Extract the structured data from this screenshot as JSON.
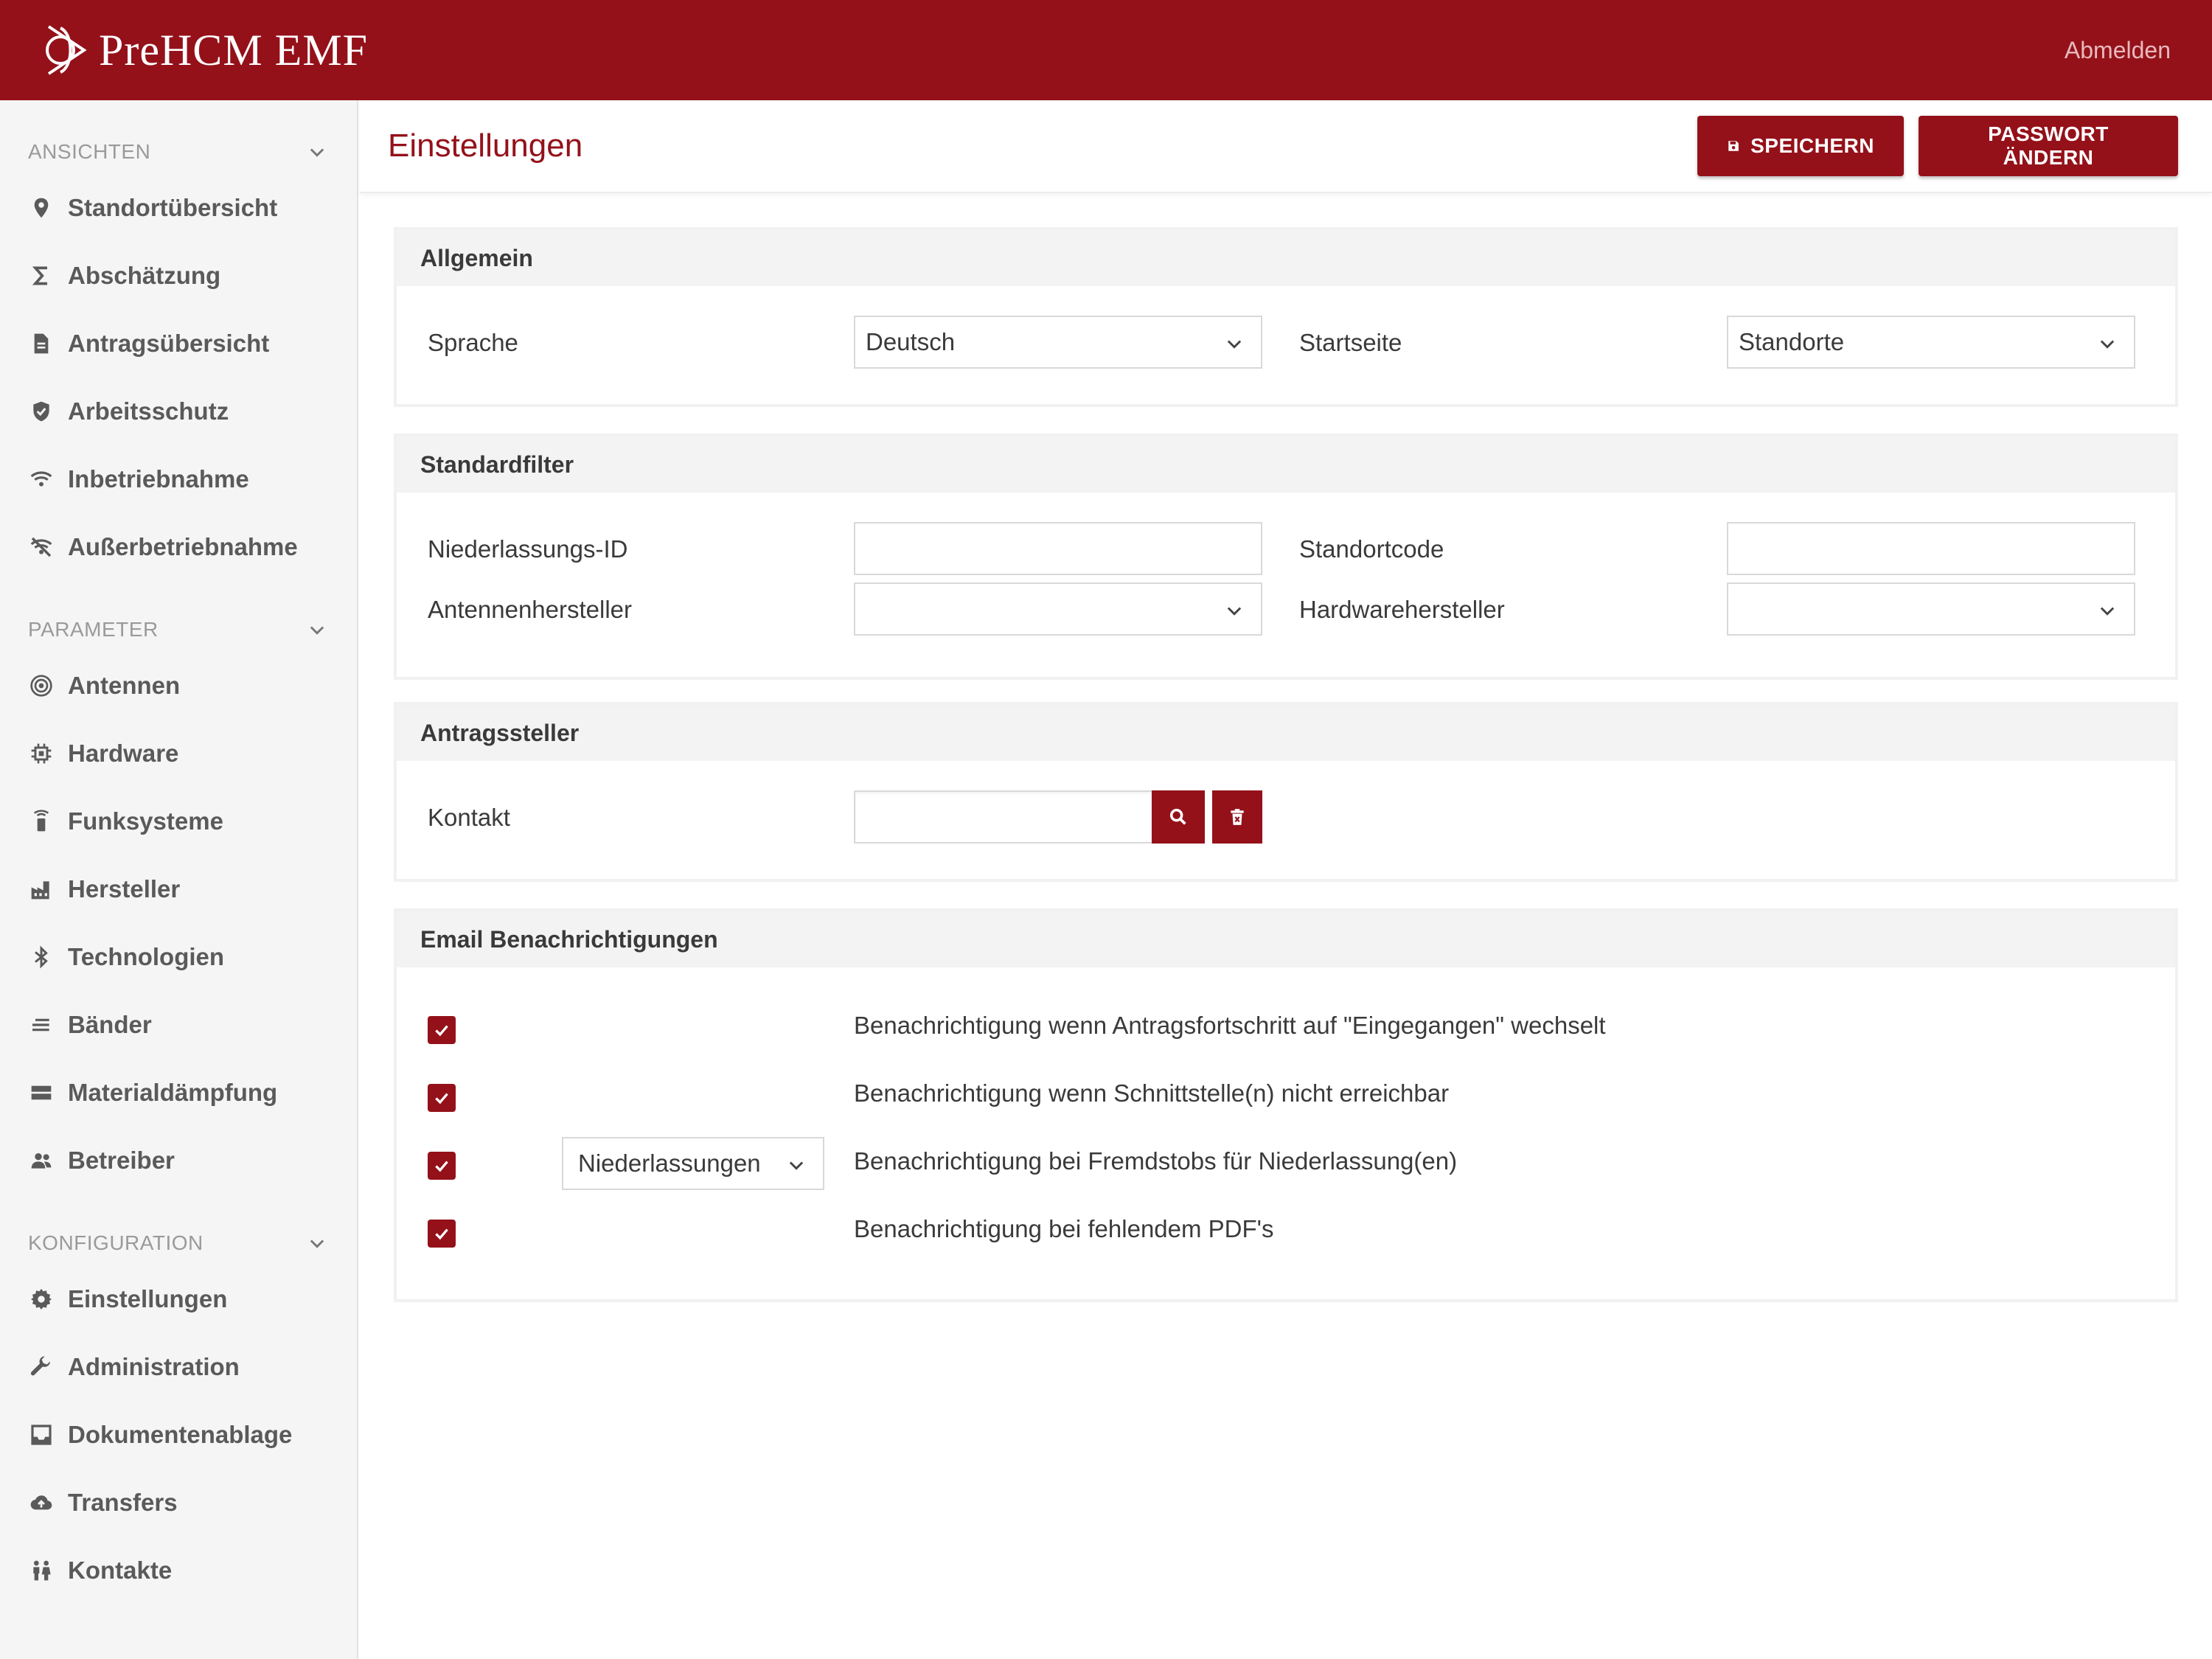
{
  "app": {
    "brand": "PreHCM EMF",
    "logout": "Abmelden"
  },
  "sidebar": {
    "sections": [
      {
        "title": "ANSICHTEN",
        "items": [
          {
            "label": "Standortübersicht",
            "icon": "map-pin-icon"
          },
          {
            "label": "Abschätzung",
            "icon": "sigma-icon"
          },
          {
            "label": "Antragsübersicht",
            "icon": "document-icon"
          },
          {
            "label": "Arbeitsschutz",
            "icon": "shield-icon"
          },
          {
            "label": "Inbetriebnahme",
            "icon": "wifi-icon"
          },
          {
            "label": "Außerbetriebnahme",
            "icon": "wifi-off-icon"
          }
        ]
      },
      {
        "title": "PARAMETER",
        "items": [
          {
            "label": "Antennen",
            "icon": "antenna-icon"
          },
          {
            "label": "Hardware",
            "icon": "chip-icon"
          },
          {
            "label": "Funksysteme",
            "icon": "radio-tower-icon"
          },
          {
            "label": "Hersteller",
            "icon": "factory-icon"
          },
          {
            "label": "Technologien",
            "icon": "bluetooth-icon"
          },
          {
            "label": "Bänder",
            "icon": "lines-icon"
          },
          {
            "label": "Materialdämpfung",
            "icon": "wall-icon"
          },
          {
            "label": "Betreiber",
            "icon": "people-icon"
          }
        ]
      },
      {
        "title": "KONFIGURATION",
        "items": [
          {
            "label": "Einstellungen",
            "icon": "gear-icon"
          },
          {
            "label": "Administration",
            "icon": "wrench-icon"
          },
          {
            "label": "Dokumentenablage",
            "icon": "inbox-icon"
          },
          {
            "label": "Transfers",
            "icon": "cloud-upload-icon"
          },
          {
            "label": "Kontakte",
            "icon": "contacts-icon"
          }
        ]
      }
    ]
  },
  "page": {
    "title": "Einstellungen",
    "save_label": "SPEICHERN",
    "password_label": "PASSWORT ÄNDERN"
  },
  "general": {
    "title": "Allgemein",
    "language_label": "Sprache",
    "language_value": "Deutsch",
    "startpage_label": "Startseite",
    "startpage_value": "Standorte"
  },
  "filters": {
    "title": "Standardfilter",
    "branch_id_label": "Niederlassungs-ID",
    "branch_id_value": "",
    "site_code_label": "Standortcode",
    "site_code_value": "",
    "antenna_mfr_label": "Antennenhersteller",
    "antenna_mfr_value": "",
    "hardware_mfr_label": "Hardwarehersteller",
    "hardware_mfr_value": ""
  },
  "applicant": {
    "title": "Antragssteller",
    "contact_label": "Kontakt",
    "contact_value": ""
  },
  "email": {
    "title": "Email Benachrichtigungen",
    "branch_select_value": "Niederlassungen",
    "items": [
      {
        "text": "Benachrichtigung wenn Antragsfortschritt auf \"Eingegangen\" wechselt",
        "checked": true
      },
      {
        "text": "Benachrichtigung wenn Schnittstelle(n) nicht erreichbar",
        "checked": true
      },
      {
        "text": "Benachrichtigung bei Fremdstobs für Niederlassung(en)",
        "checked": true
      },
      {
        "text": "Benachrichtigung bei fehlendem PDF's",
        "checked": true
      }
    ]
  },
  "colors": {
    "brand": "#94111a",
    "sidebar_bg": "#f5f5f5",
    "section_bg": "#f3f3f3"
  }
}
